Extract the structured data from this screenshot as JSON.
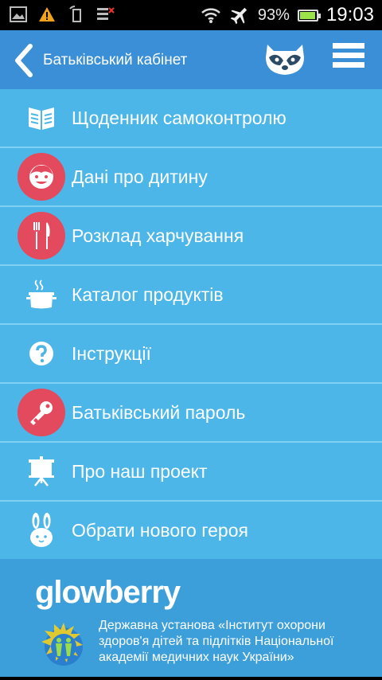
{
  "status_bar": {
    "battery_percent": "93%",
    "time": "19:03",
    "battery_level": 0.93
  },
  "header": {
    "title": "Батьківський кабінет"
  },
  "menu": {
    "items": [
      {
        "label": "Щоденник самоконтролю",
        "icon": "book-icon",
        "badge": false
      },
      {
        "label": "Дані про дитину",
        "icon": "child-face-icon",
        "badge": true
      },
      {
        "label": "Розклад харчування",
        "icon": "fork-knife-icon",
        "badge": true
      },
      {
        "label": "Каталог продуктів",
        "icon": "pot-icon",
        "badge": false
      },
      {
        "label": "Інструкції",
        "icon": "question-icon",
        "badge": false
      },
      {
        "label": "Батьківський пароль",
        "icon": "key-icon",
        "badge": true
      },
      {
        "label": "Про наш проект",
        "icon": "presentation-icon",
        "badge": false
      },
      {
        "label": "Обрати нового героя",
        "icon": "bunny-icon",
        "badge": false
      }
    ]
  },
  "footer": {
    "logo_text": "glowberry",
    "institute_text": "Державна установа «Інститут охорони здоров'я дітей та підлітків Національної академії медичних наук України»"
  },
  "colors": {
    "header_bg": "#3a8fd6",
    "row_bg": "#4bb6e7",
    "badge_red": "#e34a5e",
    "footer_bg": "#3d9fd9"
  }
}
